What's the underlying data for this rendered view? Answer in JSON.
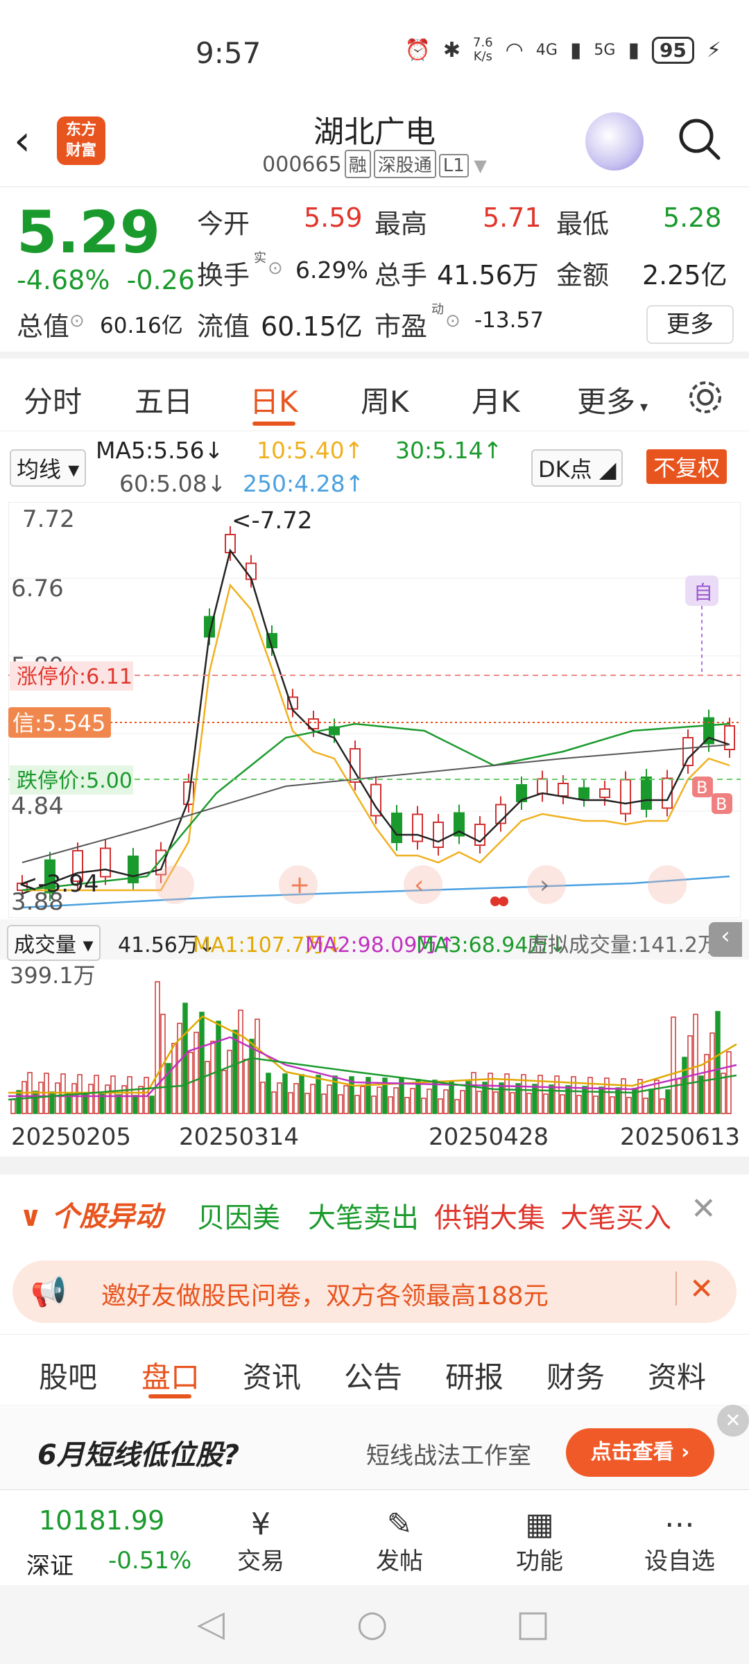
{
  "status": {
    "time": "9:57",
    "net_speed_top": "7.6",
    "net_speed_bottom": "K/s",
    "sig1": "4G",
    "sig2": "5G",
    "battery": "95"
  },
  "header": {
    "name": "湖北广电",
    "code": "000665",
    "tag1": "融",
    "tag2": "深股通",
    "tag3": "L1",
    "logo_top": "东方",
    "logo_bottom": "财富"
  },
  "quote": {
    "price": "5.29",
    "change_pct": "-4.68%",
    "change": "-0.26",
    "open_label": "今开",
    "open": "5.59",
    "high_label": "最高",
    "high": "5.71",
    "low_label": "最低",
    "low": "5.28",
    "turnover_label": "换手",
    "turnover_sup": "实",
    "turnover": "6.29%",
    "volume_label": "总手",
    "volume": "41.56万",
    "amount_label": "金额",
    "amount": "2.25亿",
    "mcap_label": "总值",
    "mcap": "60.16亿",
    "float_label": "流值",
    "float": "60.15亿",
    "pe_label": "市盈",
    "pe_sup": "动",
    "pe": "-13.57",
    "more": "更多"
  },
  "tabs": [
    "分时",
    "五日",
    "日K",
    "周K",
    "月K",
    "更多"
  ],
  "ma": {
    "select": "均线",
    "ma5": "MA5:5.56↓",
    "ma10": "10:5.40↑",
    "ma30": "30:5.14↑",
    "ma60": "60:5.08↓",
    "ma250": "250:4.28↑",
    "dk": "DK点",
    "fuquan": "不复权",
    "ma5_color": "#222",
    "ma10_color": "#f0b020",
    "ma30_color": "#1a9a2c",
    "ma60_color": "#555",
    "ma250_color": "#4aa0e0"
  },
  "chart": {
    "y_labels": [
      "7.72",
      "6.76",
      "5.80",
      "4.84",
      "3.88"
    ],
    "max_label": "<-7.72",
    "min_label": "<-3.94",
    "limit_up": "涨停价:6.11",
    "xin": "信:5.545",
    "limit_down": "跌停价:5.00",
    "zi": "自",
    "b": "B"
  },
  "volume": {
    "select": "成交量",
    "vol": "41.56万↓",
    "ma1": "MA1:107.7万↓",
    "ma2": "MA2:98.09万↑",
    "ma3": "MA3:68.94万↓",
    "virtual": "虚拟成交量:141.2万",
    "max": "399.1万"
  },
  "dates": [
    "20250205",
    "20250314",
    "20250428",
    "20250613"
  ],
  "news": {
    "title": "个股异动",
    "items": [
      "贝因美",
      "大笔卖出",
      "供销大集",
      "大笔买入"
    ]
  },
  "promo": "邀好友做股民问卷，双方各领最高188元",
  "btabs": [
    "股吧",
    "盘口",
    "资讯",
    "公告",
    "研报",
    "财务",
    "资料"
  ],
  "ad": {
    "title": "6月短线低位股?",
    "sub": "短线战法工作室",
    "btn": "点击查看 ›"
  },
  "nav": {
    "index_value": "10181.99",
    "index_name": "深证",
    "index_change": "-0.51%",
    "trade": "交易",
    "post": "发帖",
    "func": "功能",
    "watch": "设自选"
  }
}
